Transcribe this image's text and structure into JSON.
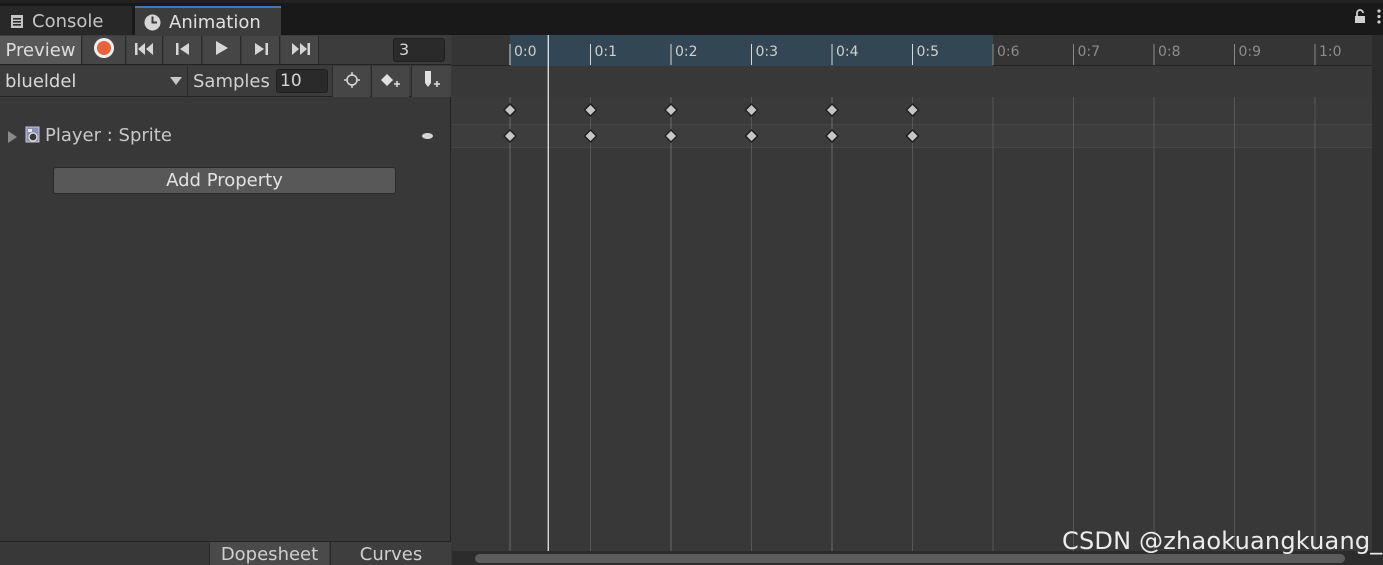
{
  "tabs": {
    "console": "Console",
    "animation": "Animation"
  },
  "toolbar": {
    "preview_label": "Preview",
    "frame_value": "3",
    "clip_name": "blueldel",
    "samples_label": "Samples",
    "samples_value": "10"
  },
  "properties": [
    {
      "label": "Player : Sprite"
    }
  ],
  "add_property_label": "Add Property",
  "bottom_tabs": {
    "dopesheet": "Dopesheet",
    "curves": "Curves"
  },
  "timeline": {
    "ticks": [
      "0:0",
      "0:1",
      "0:2",
      "0:3",
      "0:4",
      "0:5",
      "0:6",
      "0:7",
      "0:8",
      "0:9",
      "1:0"
    ],
    "selection_range": [
      0,
      6
    ],
    "current_frame": 0.5,
    "keyframes": [
      0,
      1,
      2,
      3,
      4,
      5
    ]
  },
  "colors": {
    "record": "#e8643c",
    "selection": "#324654",
    "accent_tab": "#3a79bb"
  },
  "watermark": "CSDN @zhaokuangkuang_"
}
